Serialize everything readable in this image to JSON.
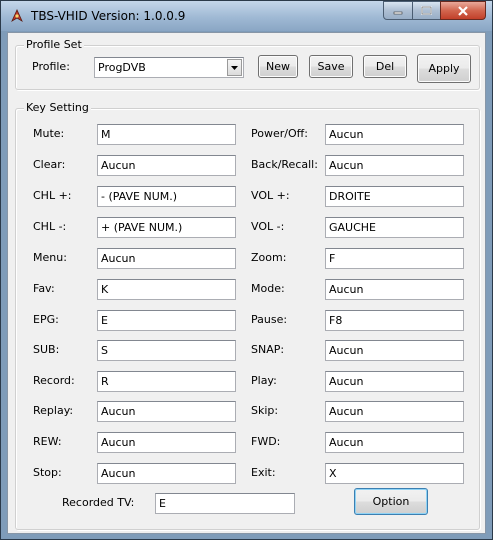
{
  "window": {
    "title": "TBS-VHID Version: 1.0.0.9"
  },
  "profile_set": {
    "legend": "Profile Set",
    "profile_label": "Profile:",
    "profile_value": "ProgDVB",
    "new_label": "New",
    "save_label": "Save",
    "del_label": "Del",
    "apply_label": "Apply"
  },
  "key_setting": {
    "legend": "Key Setting",
    "left": [
      {
        "label": "Mute:",
        "value": "M"
      },
      {
        "label": "Clear:",
        "value": "Aucun"
      },
      {
        "label": "CHL +:",
        "value": "- (PAVE NUM.)"
      },
      {
        "label": "CHL -:",
        "value": "+ (PAVE NUM.)"
      },
      {
        "label": "Menu:",
        "value": "Aucun"
      },
      {
        "label": "Fav:",
        "value": "K"
      },
      {
        "label": "EPG:",
        "value": "E"
      },
      {
        "label": "SUB:",
        "value": "S"
      },
      {
        "label": "Record:",
        "value": "R"
      },
      {
        "label": "Replay:",
        "value": "Aucun"
      },
      {
        "label": "REW:",
        "value": "Aucun"
      },
      {
        "label": "Stop:",
        "value": "Aucun"
      }
    ],
    "right": [
      {
        "label": "Power/Off:",
        "value": "Aucun"
      },
      {
        "label": "Back/Recall:",
        "value": "Aucun"
      },
      {
        "label": "VOL +:",
        "value": "DROITE"
      },
      {
        "label": "VOL -:",
        "value": "GAUCHE"
      },
      {
        "label": "Zoom:",
        "value": "F"
      },
      {
        "label": "Mode:",
        "value": "Aucun"
      },
      {
        "label": "Pause:",
        "value": "F8"
      },
      {
        "label": "SNAP:",
        "value": "Aucun"
      },
      {
        "label": "Play:",
        "value": "Aucun"
      },
      {
        "label": "Skip:",
        "value": "Aucun"
      },
      {
        "label": "FWD:",
        "value": "Aucun"
      },
      {
        "label": "Exit:",
        "value": "X"
      }
    ],
    "recorded_tv_label": "Recorded TV:",
    "recorded_tv_value": "E",
    "option_label": "Option"
  }
}
